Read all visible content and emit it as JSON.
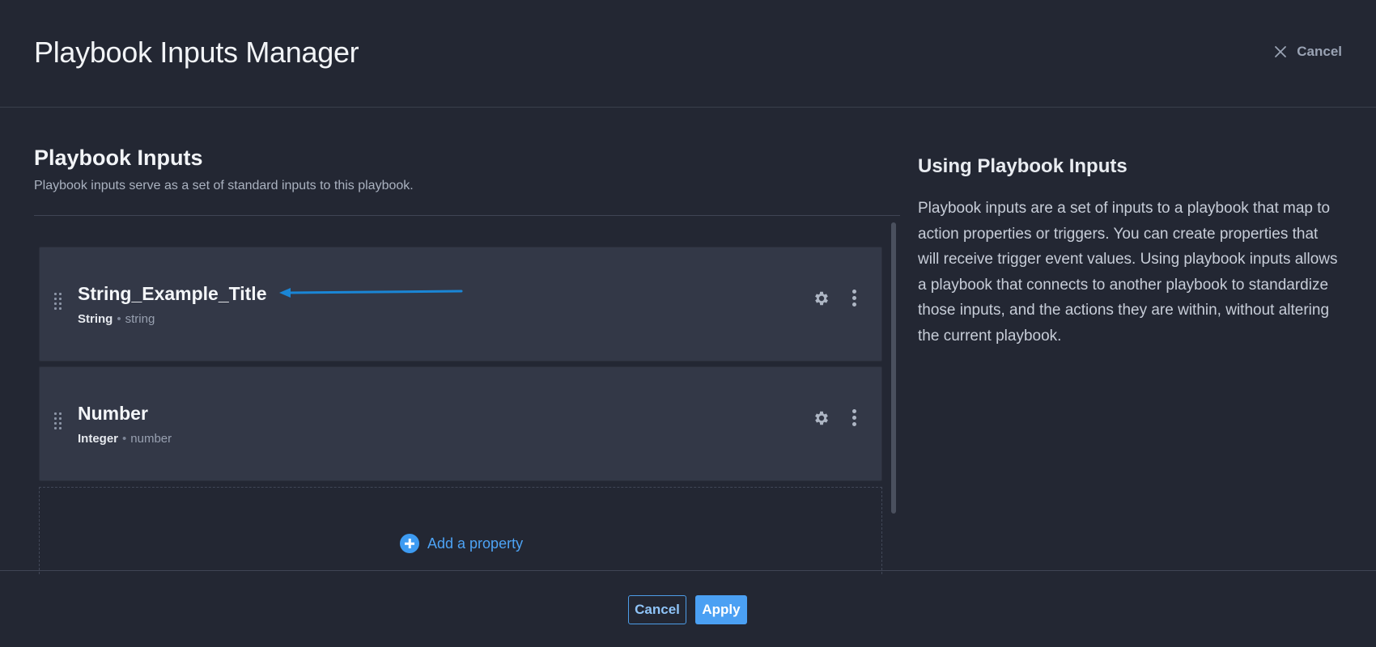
{
  "header": {
    "title": "Playbook Inputs Manager",
    "cancel_label": "Cancel",
    "cancel_icon": "close-icon"
  },
  "left": {
    "title": "Playbook Inputs",
    "description": "Playbook inputs serve as a set of standard inputs to this playbook."
  },
  "properties": [
    {
      "name": "String_Example_Title",
      "type": "String",
      "key": "string"
    },
    {
      "name": "Number",
      "type": "Integer",
      "key": "number"
    }
  ],
  "add_property_label": "Add a property",
  "help": {
    "title": "Using Playbook Inputs",
    "body": "Playbook inputs are a set of inputs to a playbook that map to action properties or triggers. You can create properties that will receive trigger event values. Using playbook inputs allows a playbook that connects to another playbook to standardize those inputs, and the actions they are within, without altering the current playbook."
  },
  "footer": {
    "cancel_label": "Cancel",
    "apply_label": "Apply"
  },
  "colors": {
    "background": "#232733",
    "card": "#333847",
    "accent": "#4ba0f3",
    "annotation_arrow": "#1a86d6"
  }
}
